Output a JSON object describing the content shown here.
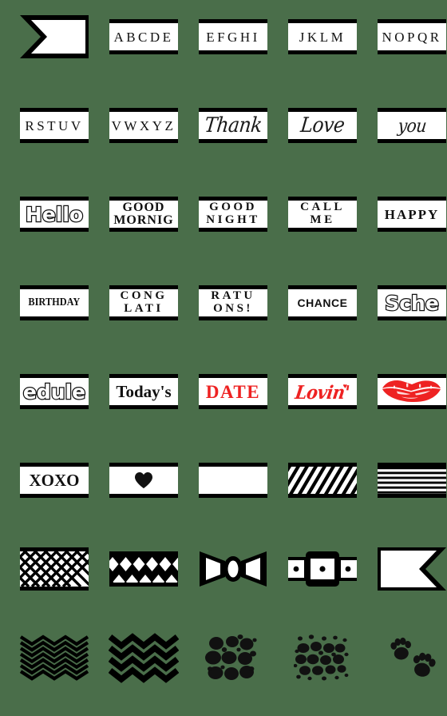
{
  "page": {
    "title": "Emoji Sticker Sheet",
    "background_color": "#4a6e4a",
    "columns": 5,
    "rows": 8,
    "accent_color": "#ee2222",
    "ink_color": "#000000",
    "label_color": "#ffffff"
  },
  "stickers": [
    {
      "index": 1,
      "row": 1,
      "col": 1,
      "name": "flag-banner-left-notch",
      "kind": "shape",
      "icon": "flag-notch-left-icon",
      "text": ""
    },
    {
      "index": 2,
      "row": 1,
      "col": 2,
      "name": "label-abcde",
      "kind": "text",
      "text": "ABCDE",
      "style": "serif-caps-tracked",
      "color": "#111111"
    },
    {
      "index": 3,
      "row": 1,
      "col": 3,
      "name": "label-efghi",
      "kind": "text",
      "text": "EFGHI",
      "style": "serif-caps-tracked",
      "color": "#111111"
    },
    {
      "index": 4,
      "row": 1,
      "col": 4,
      "name": "label-jklm",
      "kind": "text",
      "text": "JKLM",
      "style": "serif-caps-tracked",
      "color": "#111111"
    },
    {
      "index": 5,
      "row": 1,
      "col": 5,
      "name": "label-nopqr",
      "kind": "text",
      "text": "NOPQR",
      "style": "serif-caps-tracked",
      "color": "#111111"
    },
    {
      "index": 6,
      "row": 2,
      "col": 1,
      "name": "label-rstuv",
      "kind": "text",
      "text": "RSTUV",
      "style": "serif-caps-tracked",
      "color": "#111111"
    },
    {
      "index": 7,
      "row": 2,
      "col": 2,
      "name": "label-vwxyz",
      "kind": "text",
      "text": "VWXYZ",
      "style": "serif-caps-tracked",
      "color": "#111111"
    },
    {
      "index": 8,
      "row": 2,
      "col": 3,
      "name": "label-thank",
      "kind": "text",
      "text": "Thank",
      "style": "script",
      "color": "#1a1a1a"
    },
    {
      "index": 9,
      "row": 2,
      "col": 4,
      "name": "label-love",
      "kind": "text",
      "text": "Love",
      "style": "script",
      "color": "#1a1a1a"
    },
    {
      "index": 10,
      "row": 2,
      "col": 5,
      "name": "label-you",
      "kind": "text",
      "text": "you",
      "style": "script-small",
      "color": "#1a1a1a"
    },
    {
      "index": 11,
      "row": 3,
      "col": 1,
      "name": "label-hello",
      "kind": "text",
      "text": "Hello",
      "style": "outline",
      "color": "#111111"
    },
    {
      "index": 12,
      "row": 3,
      "col": 2,
      "name": "label-good-mornig",
      "kind": "text",
      "text": "GOOD\nMORNIG",
      "style": "serif-bold-two-line",
      "color": "#111111"
    },
    {
      "index": 13,
      "row": 3,
      "col": 3,
      "name": "label-good-night",
      "kind": "text",
      "text": "GOOD\nNIGHT",
      "style": "serif-bold-wide-two-line",
      "color": "#111111"
    },
    {
      "index": 14,
      "row": 3,
      "col": 4,
      "name": "label-call-me",
      "kind": "text",
      "text": "CALL\nME",
      "style": "serif-bold-wide-two-line",
      "color": "#111111"
    },
    {
      "index": 15,
      "row": 3,
      "col": 5,
      "name": "label-happy",
      "kind": "text",
      "text": "HAPPY",
      "style": "serif-bold",
      "color": "#111111"
    },
    {
      "index": 16,
      "row": 4,
      "col": 1,
      "name": "label-birthday",
      "kind": "text",
      "text": "BIRTHDAY",
      "style": "serif-condensed",
      "color": "#111111"
    },
    {
      "index": 17,
      "row": 4,
      "col": 2,
      "name": "label-cong-lati",
      "kind": "text",
      "text": "CONG\nLATI",
      "style": "serif-bold-wide-two-line",
      "color": "#111111"
    },
    {
      "index": 18,
      "row": 4,
      "col": 3,
      "name": "label-ratu-ons",
      "kind": "text",
      "text": "RATU\nONS!",
      "style": "serif-bold-wide-two-line",
      "color": "#111111"
    },
    {
      "index": 19,
      "row": 4,
      "col": 4,
      "name": "label-chance",
      "kind": "text",
      "text": "CHANCE",
      "style": "sans-bold",
      "color": "#111111"
    },
    {
      "index": 20,
      "row": 4,
      "col": 5,
      "name": "label-sche",
      "kind": "text",
      "text": "Sche",
      "style": "outline",
      "color": "#111111"
    },
    {
      "index": 21,
      "row": 5,
      "col": 1,
      "name": "label-edule",
      "kind": "text",
      "text": "edule",
      "style": "outline",
      "color": "#111111"
    },
    {
      "index": 22,
      "row": 5,
      "col": 2,
      "name": "label-todays",
      "kind": "text",
      "text": "Today's",
      "style": "serif-bold-large",
      "color": "#111111"
    },
    {
      "index": 23,
      "row": 5,
      "col": 3,
      "name": "label-date",
      "kind": "text",
      "text": "DATE",
      "style": "serif-bold-red",
      "color": "#ee2222"
    },
    {
      "index": 24,
      "row": 5,
      "col": 4,
      "name": "label-lovin",
      "kind": "text",
      "text": "Lovin'",
      "style": "script-red-with-heart",
      "color": "#ee2222"
    },
    {
      "index": 25,
      "row": 5,
      "col": 5,
      "name": "lips-kiss-mark",
      "kind": "shape",
      "icon": "lips-kiss-icon",
      "text": "",
      "color": "#ee2222"
    },
    {
      "index": 26,
      "row": 6,
      "col": 1,
      "name": "label-xoxo",
      "kind": "text",
      "text": "XOXO",
      "style": "serif-bold-large",
      "color": "#111111"
    },
    {
      "index": 27,
      "row": 6,
      "col": 2,
      "name": "label-heart",
      "kind": "shape",
      "icon": "heart-icon",
      "text": "♥",
      "color": "#111111"
    },
    {
      "index": 28,
      "row": 6,
      "col": 3,
      "name": "label-blank",
      "kind": "shape",
      "icon": "blank-label-icon",
      "text": ""
    },
    {
      "index": 29,
      "row": 6,
      "col": 4,
      "name": "pattern-diagonal-stripes",
      "kind": "pattern",
      "icon": "diagonal-stripes-icon",
      "text": ""
    },
    {
      "index": 30,
      "row": 6,
      "col": 5,
      "name": "pattern-horizontal-stripes",
      "kind": "pattern",
      "icon": "horizontal-stripes-icon",
      "text": ""
    },
    {
      "index": 31,
      "row": 7,
      "col": 1,
      "name": "pattern-lattice",
      "kind": "pattern",
      "icon": "lattice-icon",
      "text": ""
    },
    {
      "index": 32,
      "row": 7,
      "col": 2,
      "name": "pattern-argyle-diamonds",
      "kind": "pattern",
      "icon": "argyle-diamond-icon",
      "text": ""
    },
    {
      "index": 33,
      "row": 7,
      "col": 3,
      "name": "bow-tie-ribbon",
      "kind": "shape",
      "icon": "bow-tie-icon",
      "text": ""
    },
    {
      "index": 34,
      "row": 7,
      "col": 4,
      "name": "belt-buckle-strap",
      "kind": "shape",
      "icon": "belt-buckle-icon",
      "text": ""
    },
    {
      "index": 35,
      "row": 7,
      "col": 5,
      "name": "flag-banner-right-notch",
      "kind": "shape",
      "icon": "flag-notch-right-icon",
      "text": ""
    },
    {
      "index": 36,
      "row": 8,
      "col": 1,
      "name": "pattern-chevron-thin",
      "kind": "pattern",
      "icon": "chevron-thin-icon",
      "text": ""
    },
    {
      "index": 37,
      "row": 8,
      "col": 2,
      "name": "pattern-chevron-thick",
      "kind": "pattern",
      "icon": "chevron-thick-icon",
      "text": ""
    },
    {
      "index": 38,
      "row": 8,
      "col": 3,
      "name": "pattern-dalmatian-dots-large",
      "kind": "pattern",
      "icon": "dalmatian-dots-large-icon",
      "text": ""
    },
    {
      "index": 39,
      "row": 8,
      "col": 4,
      "name": "pattern-dalmatian-dots-small",
      "kind": "pattern",
      "icon": "dalmatian-dots-small-icon",
      "text": ""
    },
    {
      "index": 40,
      "row": 8,
      "col": 5,
      "name": "paw-prints",
      "kind": "shape",
      "icon": "paw-prints-icon",
      "text": ""
    }
  ]
}
